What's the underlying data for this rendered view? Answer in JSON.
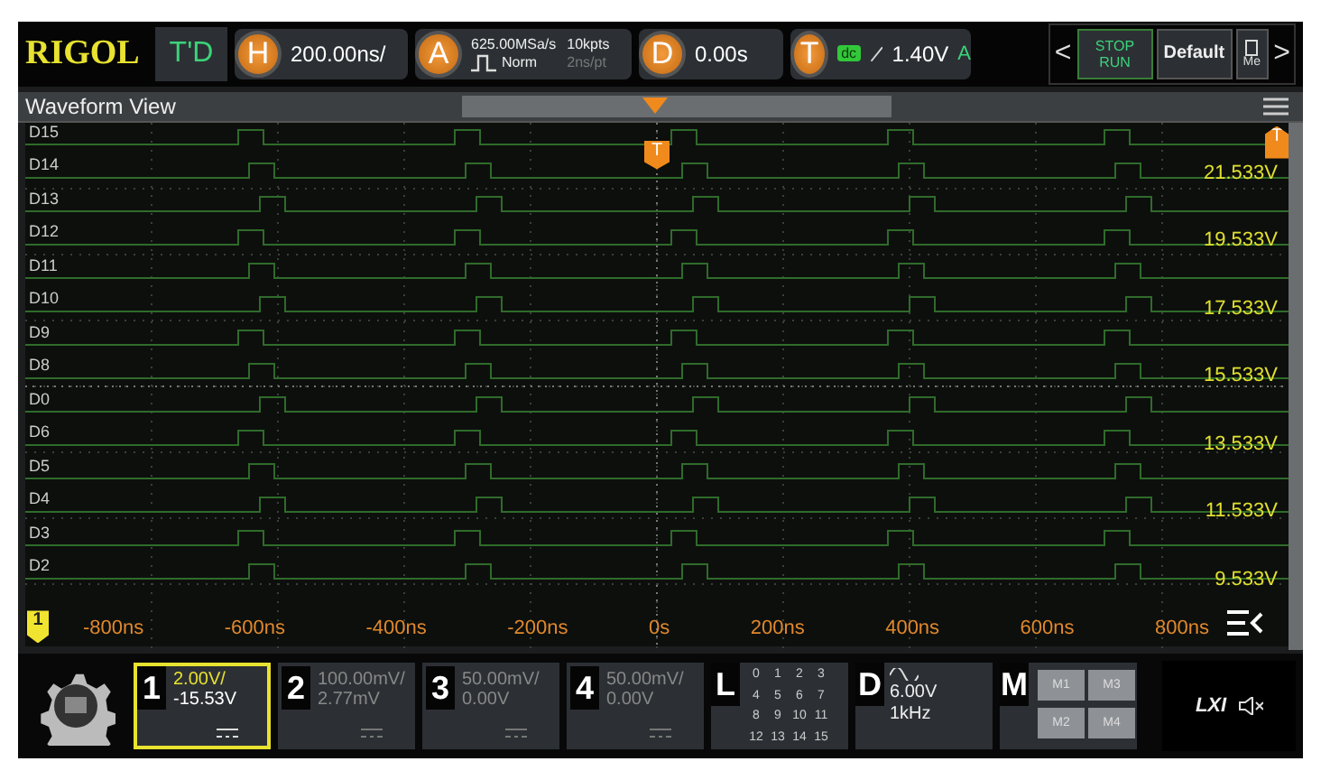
{
  "top_bar": {
    "logo": "RIGOL",
    "mode": "T'D",
    "horizontal": {
      "badge": "H",
      "value": "200.00ns/"
    },
    "acquire": {
      "badge": "A",
      "sample_rate": "625.00MSa/s",
      "memory": "10kpts",
      "mode": "Norm",
      "resolution": "2ns/pt"
    },
    "delay": {
      "badge": "D",
      "value": "0.00s"
    },
    "trigger": {
      "badge": "T",
      "coupling": "dc",
      "level": "1.40V",
      "sweep": "A"
    },
    "controls": {
      "prev": "<",
      "run_stop": {
        "top": "STOP",
        "bottom": "RUN"
      },
      "default": "Default",
      "more": "Me",
      "next": ">"
    }
  },
  "waveform_view": {
    "title": "Waveform View",
    "trigger_marker": "T",
    "level_marker": "T",
    "channel_marker": "1",
    "digital_channels": [
      "D15",
      "D14",
      "D13",
      "D12",
      "D11",
      "D10",
      "D9",
      "D8",
      "D0",
      "D6",
      "D5",
      "D4",
      "D3",
      "D2"
    ],
    "voltages": [
      "21.533V",
      "19.533V",
      "17.533V",
      "15.533V",
      "13.533V",
      "11.533V",
      "9.533V"
    ],
    "times": [
      "-800ns",
      "-600ns",
      "-400ns",
      "-200ns",
      "0s",
      "200ns",
      "400ns",
      "600ns",
      "800ns"
    ]
  },
  "bottom_bar": {
    "channels": [
      {
        "number": "1",
        "scale": "2.00V/",
        "offset": "-15.53V",
        "on": true,
        "selected": true
      },
      {
        "number": "2",
        "scale": "100.00mV/",
        "offset": "2.77mV",
        "on": false,
        "selected": false
      },
      {
        "number": "3",
        "scale": "50.00mV/",
        "offset": "0.00V",
        "on": false,
        "selected": false
      },
      {
        "number": "4",
        "scale": "50.00mV/",
        "offset": "0.00V",
        "on": false,
        "selected": false
      }
    ],
    "logic": {
      "badge": "L",
      "bits": [
        "0",
        "1",
        "2",
        "3",
        "4",
        "5",
        "6",
        "7",
        "8",
        "9",
        "10",
        "11",
        "12",
        "13",
        "14",
        "15"
      ]
    },
    "generator": {
      "badge": "D",
      "amplitude": "6.00V",
      "frequency": "1kHz"
    },
    "math": {
      "badge": "M",
      "items": [
        "M1",
        "M3",
        "M2",
        "M4"
      ]
    },
    "lxi": {
      "label": "LXI"
    }
  }
}
